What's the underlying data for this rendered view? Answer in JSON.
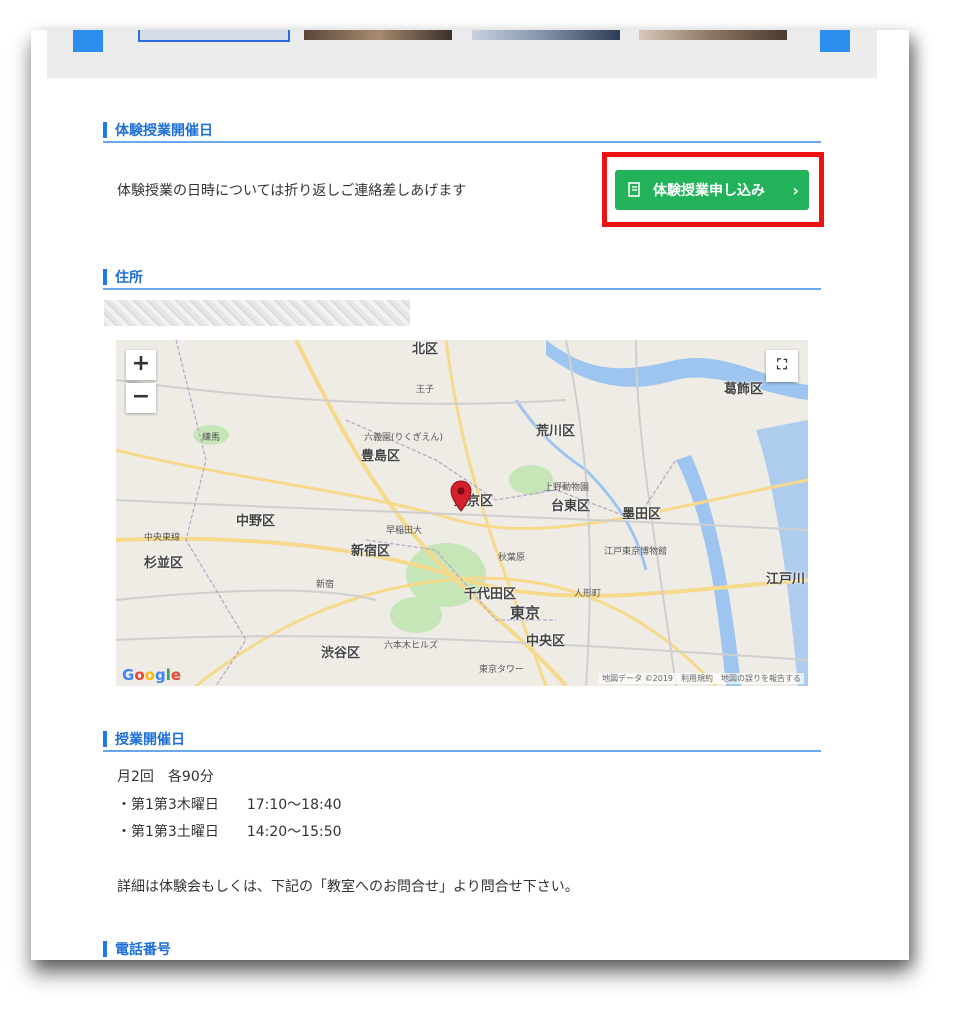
{
  "trial": {
    "heading": "体験授業開催日",
    "note": "体験授業の日時については折り返しご連絡差しあげます",
    "apply_button": "体験授業申し込み",
    "apply_chevron": "›"
  },
  "address": {
    "heading": "住所"
  },
  "map": {
    "zoom_in": "+",
    "zoom_out": "−",
    "fullscreen": "⛶",
    "google_logo": [
      "G",
      "o",
      "o",
      "g",
      "l",
      "e"
    ],
    "attribution": "地図データ ©2019　利用規約　地図の誤りを報告する",
    "labels": [
      "北区",
      "荒川区",
      "葛飾区",
      "豊島区",
      "文京区",
      "台東区",
      "墨田区",
      "中野区",
      "新宿区",
      "杉並区",
      "千代田区",
      "東京",
      "中央区",
      "江戸川",
      "渋谷区"
    ],
    "small_labels": [
      "王子",
      "六義園(りくぎえん)",
      "上野動物園",
      "早稲田大",
      "江戸東京博物館",
      "六本木ヒルズ",
      "東京タワー",
      "練馬",
      "中央東線",
      "秋葉原",
      "人形町",
      "新宿"
    ],
    "colors": {
      "water": "#9ec5f0",
      "park": "#c6e6b8",
      "road": "#f6d98a",
      "pin": "#d3202b"
    }
  },
  "schedule": {
    "heading": "授業開催日",
    "lines": [
      "月2回　各90分",
      "・第1第3木曜日　　17:10〜18:40",
      "・第1第3土曜日　　14:20〜15:50"
    ],
    "details": "詳細は体験会もしくは、下記の「教室へのお問合せ」より問合せ下さい。"
  },
  "phone": {
    "heading": "電話番号"
  },
  "colors": {
    "accent": "#1e7ae6",
    "button": "#22b25a",
    "highlight": "#ee1111"
  }
}
